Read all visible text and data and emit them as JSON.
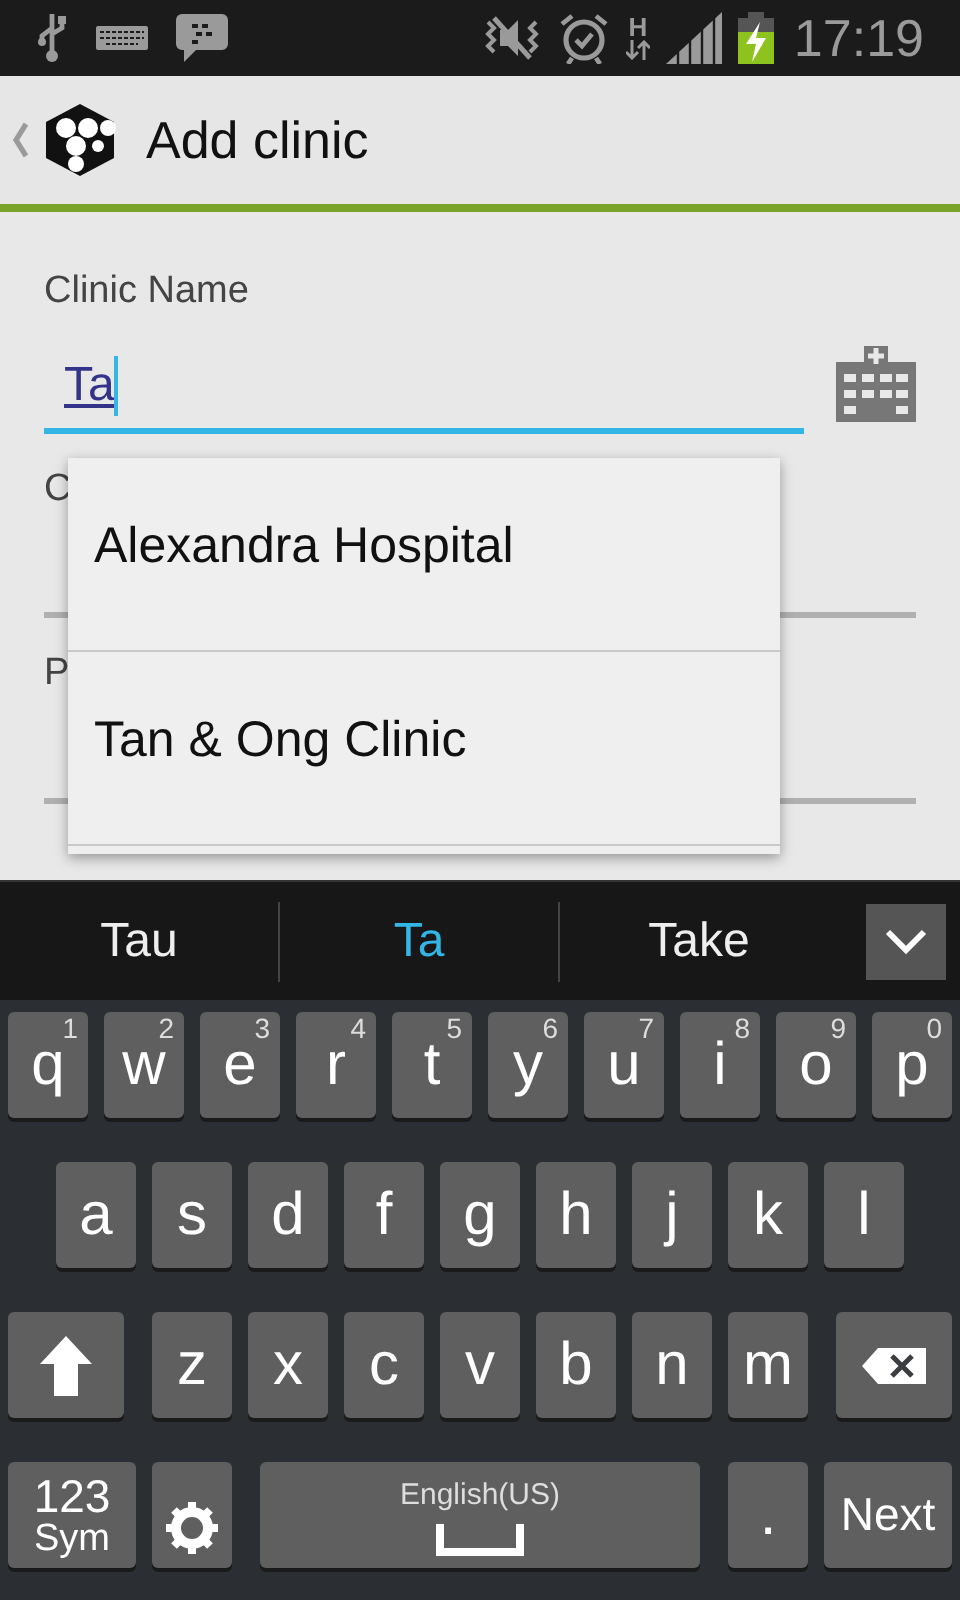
{
  "status_bar": {
    "network_type": "H",
    "time": "17:19",
    "battery_charging": true
  },
  "action_bar": {
    "title": "Add clinic"
  },
  "form": {
    "fields": [
      {
        "label": "Clinic Name",
        "value": "Ta",
        "focused": true,
        "composing": true
      },
      {
        "label": "C",
        "focused": false
      },
      {
        "label": "P",
        "focused": false
      }
    ]
  },
  "suggestions_dropdown": {
    "items": [
      {
        "label": "Alexandra Hospital"
      },
      {
        "label": "Tan & Ong Clinic"
      }
    ]
  },
  "keyboard": {
    "suggestions": [
      {
        "label": "Tau",
        "selected": false
      },
      {
        "label": "Ta",
        "selected": true
      },
      {
        "label": "Take",
        "selected": false
      }
    ],
    "rows": [
      [
        {
          "kind": "letter",
          "label": "q",
          "hint": "1"
        },
        {
          "kind": "letter",
          "label": "w",
          "hint": "2"
        },
        {
          "kind": "letter",
          "label": "e",
          "hint": "3"
        },
        {
          "kind": "letter",
          "label": "r",
          "hint": "4"
        },
        {
          "kind": "letter",
          "label": "t",
          "hint": "5"
        },
        {
          "kind": "letter",
          "label": "y",
          "hint": "6"
        },
        {
          "kind": "letter",
          "label": "u",
          "hint": "7"
        },
        {
          "kind": "letter",
          "label": "i",
          "hint": "8"
        },
        {
          "kind": "letter",
          "label": "o",
          "hint": "9"
        },
        {
          "kind": "letter",
          "label": "p",
          "hint": "0"
        }
      ],
      [
        {
          "kind": "letter",
          "label": "a"
        },
        {
          "kind": "letter",
          "label": "s"
        },
        {
          "kind": "letter",
          "label": "d"
        },
        {
          "kind": "letter",
          "label": "f"
        },
        {
          "kind": "letter",
          "label": "g"
        },
        {
          "kind": "letter",
          "label": "h"
        },
        {
          "kind": "letter",
          "label": "j"
        },
        {
          "kind": "letter",
          "label": "k"
        },
        {
          "kind": "letter",
          "label": "l"
        }
      ],
      [
        {
          "kind": "shift"
        },
        {
          "kind": "letter",
          "label": "z"
        },
        {
          "kind": "letter",
          "label": "x"
        },
        {
          "kind": "letter",
          "label": "c"
        },
        {
          "kind": "letter",
          "label": "v"
        },
        {
          "kind": "letter",
          "label": "b"
        },
        {
          "kind": "letter",
          "label": "n"
        },
        {
          "kind": "letter",
          "label": "m"
        },
        {
          "kind": "delete"
        }
      ]
    ],
    "bottom_row": [
      {
        "kind": "sym",
        "label": "123",
        "sublabel": "Sym"
      },
      {
        "kind": "settings"
      },
      {
        "kind": "space",
        "label": "English(US)"
      },
      {
        "kind": "period",
        "label": "."
      },
      {
        "kind": "action",
        "label": "Next"
      }
    ]
  }
}
